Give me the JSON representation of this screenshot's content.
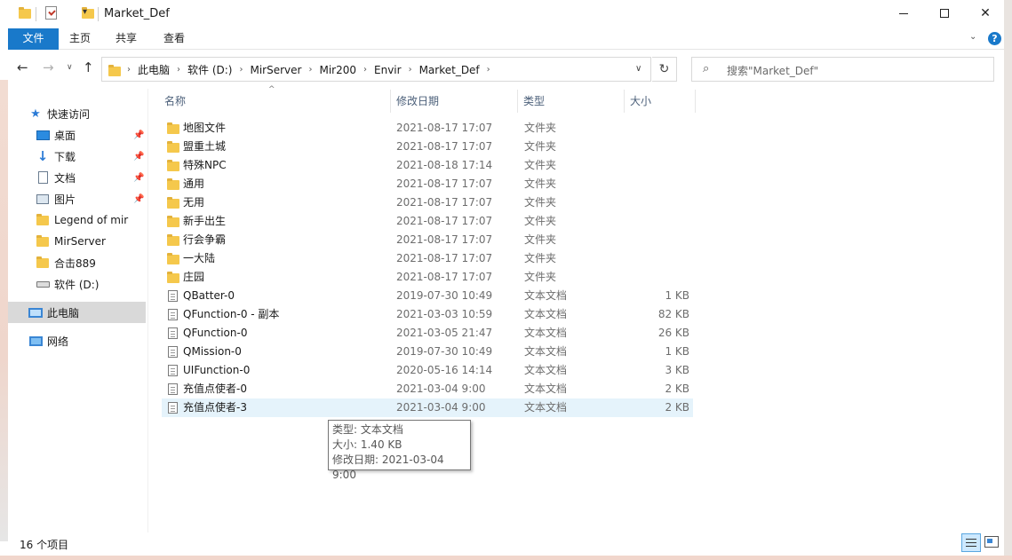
{
  "window": {
    "title": "Market_Def"
  },
  "ribbon": {
    "tabs": [
      "文件",
      "主页",
      "共享",
      "查看"
    ]
  },
  "nav": {
    "breadcrumbs": [
      "此电脑",
      "软件 (D:)",
      "MirServer",
      "Mir200",
      "Envir",
      "Market_Def"
    ],
    "search_placeholder": "搜索\"Market_Def\""
  },
  "sidebar": {
    "items": [
      {
        "label": "快速访问",
        "icon": "star-icon",
        "pinned": false
      },
      {
        "label": "桌面",
        "icon": "desktop-icon",
        "pinned": true
      },
      {
        "label": "下载",
        "icon": "download-icon",
        "pinned": true
      },
      {
        "label": "文档",
        "icon": "document-icon",
        "pinned": true
      },
      {
        "label": "图片",
        "icon": "picture-icon",
        "pinned": true
      },
      {
        "label": "Legend of mir",
        "icon": "folder-icon",
        "pinned": false
      },
      {
        "label": "MirServer",
        "icon": "folder-icon",
        "pinned": false
      },
      {
        "label": "合击889",
        "icon": "folder-icon",
        "pinned": false
      },
      {
        "label": "软件 (D:)",
        "icon": "drive-icon",
        "pinned": false
      },
      {
        "label": "此电脑",
        "icon": "computer-icon",
        "pinned": false
      },
      {
        "label": "网络",
        "icon": "network-icon",
        "pinned": false
      }
    ]
  },
  "list": {
    "columns": [
      "名称",
      "修改日期",
      "类型",
      "大小"
    ],
    "rows": [
      {
        "name": "地图文件",
        "date": "2021-08-17 17:07",
        "type": "文件夹",
        "size": "",
        "kind": "folder"
      },
      {
        "name": "盟重土城",
        "date": "2021-08-17 17:07",
        "type": "文件夹",
        "size": "",
        "kind": "folder"
      },
      {
        "name": "特殊NPC",
        "date": "2021-08-18 17:14",
        "type": "文件夹",
        "size": "",
        "kind": "folder"
      },
      {
        "name": "通用",
        "date": "2021-08-17 17:07",
        "type": "文件夹",
        "size": "",
        "kind": "folder"
      },
      {
        "name": "无用",
        "date": "2021-08-17 17:07",
        "type": "文件夹",
        "size": "",
        "kind": "folder"
      },
      {
        "name": "新手出生",
        "date": "2021-08-17 17:07",
        "type": "文件夹",
        "size": "",
        "kind": "folder"
      },
      {
        "name": "行会争霸",
        "date": "2021-08-17 17:07",
        "type": "文件夹",
        "size": "",
        "kind": "folder"
      },
      {
        "name": "一大陆",
        "date": "2021-08-17 17:07",
        "type": "文件夹",
        "size": "",
        "kind": "folder"
      },
      {
        "name": "庄园",
        "date": "2021-08-17 17:07",
        "type": "文件夹",
        "size": "",
        "kind": "folder"
      },
      {
        "name": "QBatter-0",
        "date": "2019-07-30 10:49",
        "type": "文本文档",
        "size": "1 KB",
        "kind": "file"
      },
      {
        "name": "QFunction-0 - 副本",
        "date": "2021-03-03 10:59",
        "type": "文本文档",
        "size": "82 KB",
        "kind": "file"
      },
      {
        "name": "QFunction-0",
        "date": "2021-03-05 21:47",
        "type": "文本文档",
        "size": "26 KB",
        "kind": "file"
      },
      {
        "name": "QMission-0",
        "date": "2019-07-30 10:49",
        "type": "文本文档",
        "size": "1 KB",
        "kind": "file"
      },
      {
        "name": "UIFunction-0",
        "date": "2020-05-16 14:14",
        "type": "文本文档",
        "size": "3 KB",
        "kind": "file"
      },
      {
        "name": "充值点使者-0",
        "date": "2021-03-04 9:00",
        "type": "文本文档",
        "size": "2 KB",
        "kind": "file"
      },
      {
        "name": "充值点使者-3",
        "date": "2021-03-04 9:00",
        "type": "文本文档",
        "size": "2 KB",
        "kind": "file"
      }
    ]
  },
  "tooltip": {
    "line1": "类型: 文本文档",
    "line2": "大小: 1.40 KB",
    "line3": "修改日期: 2021-03-04 9:00"
  },
  "status": {
    "count": "16 个项目"
  },
  "colors": {
    "accent": "#1979ca",
    "folder": "#f5c84c",
    "selection": "#e5f3fb"
  }
}
